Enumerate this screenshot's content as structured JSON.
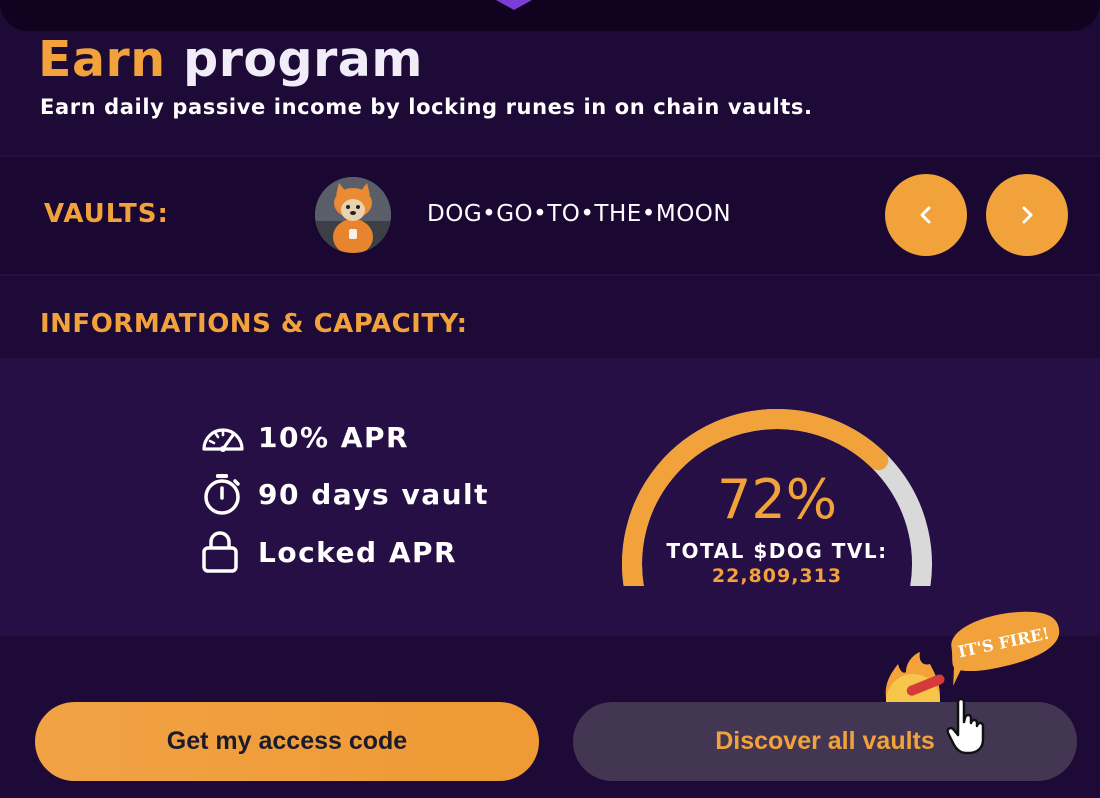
{
  "header": {
    "title_accent": "Earn",
    "title_rest": "program",
    "subtitle": "Earn daily passive income by locking runes in on chain vaults."
  },
  "vaults": {
    "label": "VAULTS:",
    "selected_name": "DOG•GO•TO•THE•MOON",
    "prev_icon": "chevron-left-icon",
    "next_icon": "chevron-right-icon"
  },
  "info": {
    "heading": "INFORMATIONS & CAPACITY:",
    "features": [
      {
        "icon": "speedometer-icon",
        "text": "10% APR"
      },
      {
        "icon": "stopwatch-icon",
        "text": "90 days vault"
      },
      {
        "icon": "lock-icon",
        "text": "Locked APR"
      }
    ]
  },
  "capacity": {
    "percent_value": 72,
    "percent_label": "72%",
    "tvl_label": "TOTAL $DOG TVL:",
    "tvl_value": "22,809,313"
  },
  "mascot": {
    "speech": "IT'S FIRE!"
  },
  "actions": {
    "primary_label": "Get my access code",
    "secondary_label": "Discover all vaults"
  },
  "colors": {
    "accent": "#f2a23a",
    "background": "#1e0a37",
    "panel": "#260f45",
    "gauge_track": "#d9d9d9",
    "secondary_button": "#433653"
  }
}
